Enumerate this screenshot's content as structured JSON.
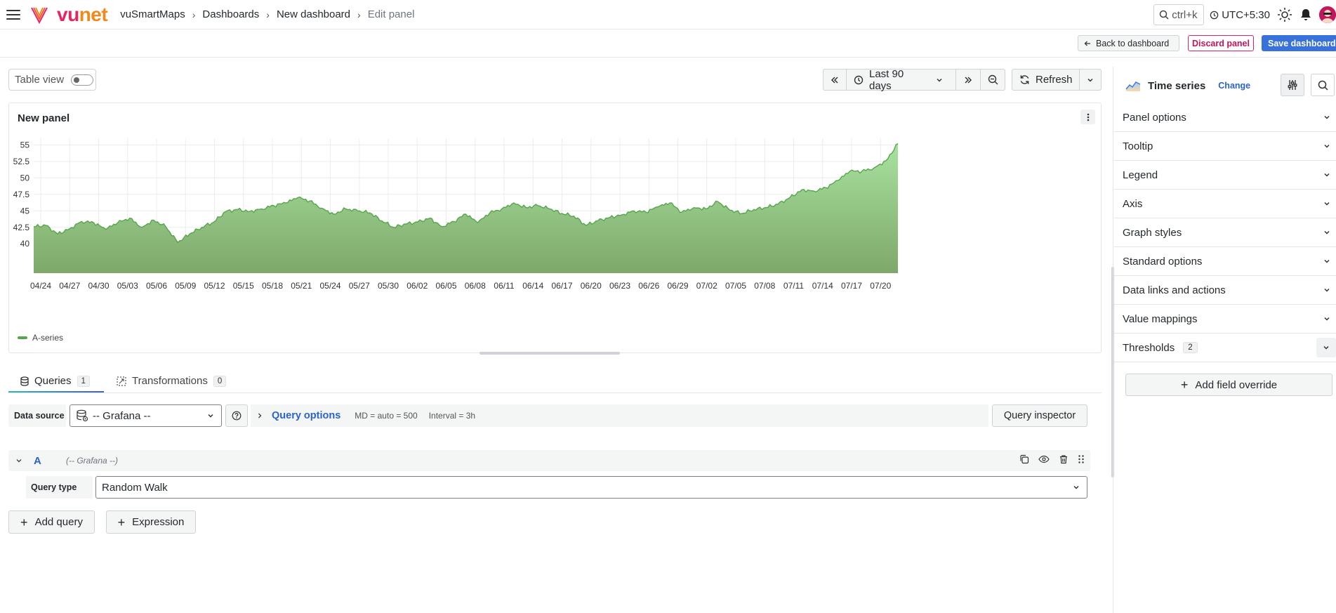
{
  "header": {
    "brand": {
      "part1": "vu",
      "part2": "net"
    },
    "breadcrumb": [
      "vuSmartMaps",
      "Dashboards",
      "New dashboard",
      "Edit panel"
    ],
    "search_shortcut": "ctrl+k",
    "timezone": "UTC+5:30"
  },
  "actions": {
    "back": "Back to dashboard",
    "discard": "Discard panel",
    "save": "Save dashboard"
  },
  "controls": {
    "table_view_label": "Table view",
    "table_view_on": false,
    "time_range": "Last 90 days",
    "refresh_label": "Refresh"
  },
  "panel": {
    "title": "New panel"
  },
  "chart_data": {
    "type": "area",
    "title": "New panel",
    "xlabel": "",
    "ylabel": "",
    "yticks": [
      "40",
      "42.5",
      "45",
      "47.5",
      "50",
      "52.5",
      "55"
    ],
    "ylim": [
      38,
      56
    ],
    "xticks": [
      "04/24",
      "04/27",
      "04/30",
      "05/03",
      "05/06",
      "05/09",
      "05/12",
      "05/15",
      "05/18",
      "05/21",
      "05/24",
      "05/27",
      "05/30",
      "06/02",
      "06/05",
      "06/08",
      "06/11",
      "06/14",
      "06/17",
      "06/20",
      "06/23",
      "06/26",
      "06/29",
      "07/02",
      "07/05",
      "07/08",
      "07/11",
      "07/14",
      "07/17",
      "07/20"
    ],
    "series": [
      {
        "name": "A-series",
        "color": "#56a64b",
        "values": [
          42.6,
          42.8,
          41.5,
          42.3,
          43.4,
          43.2,
          42.2,
          43.2,
          43.9,
          42.5,
          43.6,
          42.6,
          40.2,
          41.5,
          42.5,
          43.3,
          44.9,
          45.2,
          44.9,
          45.3,
          45.8,
          46.2,
          47.0,
          46.5,
          45.4,
          44.5,
          45.3,
          45.0,
          44.7,
          43.5,
          42.5,
          43.0,
          43.3,
          43.9,
          42.6,
          43.4,
          44.5,
          43.2,
          44.7,
          45.3,
          46.2,
          45.5,
          45.8,
          45.3,
          44.6,
          44.2,
          42.8,
          43.5,
          44.0,
          44.4,
          45.0,
          44.8,
          45.6,
          46.2,
          44.8,
          45.5,
          45.3,
          46.4,
          45.1,
          44.6,
          45.2,
          45.5,
          46.0,
          47.0,
          48.2,
          48.0,
          48.5,
          49.6,
          51.0,
          51.0,
          51.5,
          52.6,
          55.2
        ]
      }
    ]
  },
  "query_tabs": [
    {
      "label": "Queries",
      "count": "1"
    },
    {
      "label": "Transformations",
      "count": "0"
    }
  ],
  "data_source": {
    "label": "Data source",
    "value": "-- Grafana --"
  },
  "query_options": {
    "label": "Query options",
    "md": "MD = auto = 500",
    "interval": "Interval = 3h"
  },
  "query_inspector": "Query inspector",
  "query_a": {
    "ref_id": "A",
    "datasource": "(-- Grafana --)",
    "query_type_label": "Query type",
    "query_type_value": "Random Walk"
  },
  "buttons": {
    "add_query": "Add query",
    "expression": "Expression",
    "add_field_override": "Add field override"
  },
  "right_panel": {
    "viz_name": "Time series",
    "change": "Change",
    "sections": [
      {
        "label": "Panel options"
      },
      {
        "label": "Tooltip"
      },
      {
        "label": "Legend"
      },
      {
        "label": "Axis"
      },
      {
        "label": "Graph styles"
      },
      {
        "label": "Standard options"
      },
      {
        "label": "Data links and actions"
      },
      {
        "label": "Value mappings"
      },
      {
        "label": "Thresholds",
        "badge": "2"
      }
    ]
  }
}
